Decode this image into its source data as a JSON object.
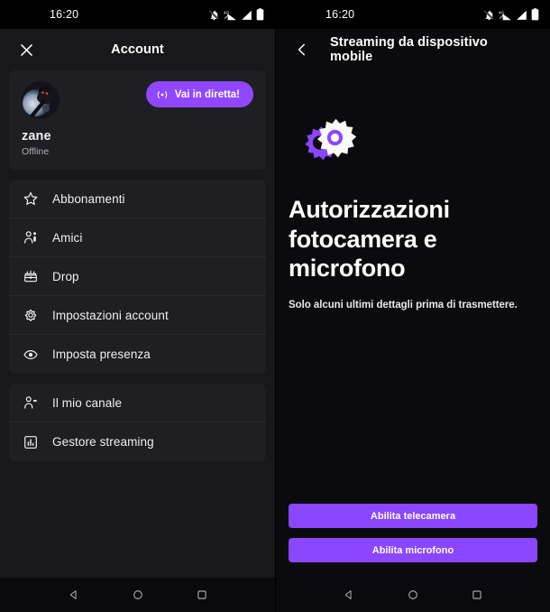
{
  "status_bar": {
    "time": "16:20",
    "icons": [
      "notifications-off-icon",
      "mobile-data-4g-icon",
      "signal-icon",
      "battery-icon"
    ]
  },
  "left_screen": {
    "appbar": {
      "close_label": "close-icon",
      "title": "Account"
    },
    "profile": {
      "username": "zane",
      "status": "Offline",
      "go_live_label": "Vai in diretta!",
      "go_live_icon": "broadcast-icon",
      "avatar_name": "user-avatar"
    },
    "menu_group_1": [
      {
        "icon": "star-icon",
        "label": "Abbonamenti"
      },
      {
        "icon": "friends-icon",
        "label": "Amici"
      },
      {
        "icon": "drop-chest-icon",
        "label": "Drop"
      },
      {
        "icon": "gear-icon",
        "label": "Impostazioni account"
      },
      {
        "icon": "eye-icon",
        "label": "Imposta presenza"
      }
    ],
    "menu_group_2": [
      {
        "icon": "my-channel-icon",
        "label": "Il mio canale"
      },
      {
        "icon": "stream-chart-icon",
        "label": "Gestore streaming"
      }
    ]
  },
  "right_screen": {
    "appbar": {
      "back_label": "back-arrow-icon",
      "title": "Streaming da dispositivo mobile"
    },
    "permissions": {
      "illustration": "dual-gears-icon",
      "title": "Autorizzazioni fotocamera e microfono",
      "subtitle": "Solo alcuni ultimi dettagli prima di trasmettere.",
      "buttons": [
        {
          "label": "Abilita telecamera"
        },
        {
          "label": "Abilita microfono"
        }
      ]
    }
  },
  "nav_bar": {
    "back": "back-triangle-icon",
    "home": "home-circle-icon",
    "recents": "recents-square-icon"
  },
  "colors": {
    "accent_purple": "#9147ff",
    "button_purple": "#8b46ff",
    "page_bg_left": "#18181b",
    "page_bg_right": "#0b0b0d",
    "card_bg": "#1f1f23",
    "text_primary": "#efeff1",
    "text_muted": "#adadb8"
  }
}
